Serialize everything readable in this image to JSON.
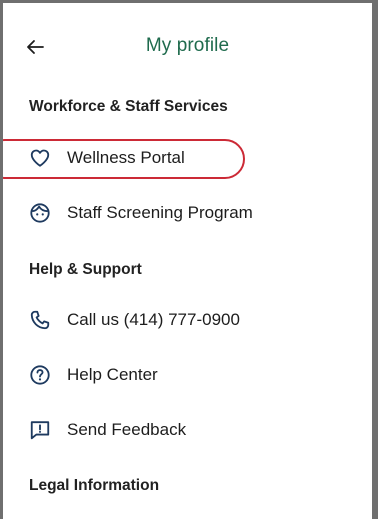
{
  "header": {
    "title": "My profile",
    "back_icon": "arrow-left-icon"
  },
  "sections": {
    "workforce": {
      "title": "Workforce & Staff Services",
      "items": [
        {
          "label": "Wellness Portal",
          "icon": "heart-icon"
        },
        {
          "label": "Staff Screening Program",
          "icon": "face-icon"
        }
      ]
    },
    "help": {
      "title": "Help & Support",
      "items": [
        {
          "label": "Call us (414) 777-0900",
          "icon": "phone-icon"
        },
        {
          "label": "Help Center",
          "icon": "question-circle-icon"
        },
        {
          "label": "Send Feedback",
          "icon": "feedback-icon"
        }
      ]
    },
    "legal": {
      "title": "Legal Information"
    }
  },
  "colors": {
    "accent": "#1f6b4d",
    "highlight": "#cc2a36"
  }
}
